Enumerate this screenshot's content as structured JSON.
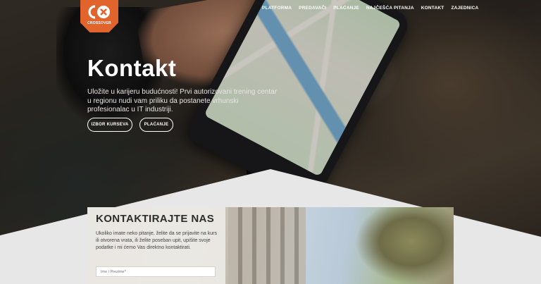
{
  "brand": {
    "logo_text": "CROSSOVER"
  },
  "nav": {
    "items": [
      {
        "label": "PLATFORMA"
      },
      {
        "label": "PREDAVAČI"
      },
      {
        "label": "PLAĆANJE"
      },
      {
        "label": "NAJČEŠĆA PITANJA"
      },
      {
        "label": "KONTAKT"
      },
      {
        "label": "ZAJEDNICA"
      }
    ]
  },
  "hero": {
    "title": "Kontakt",
    "lead": "Uložite u karijeru budućnosti! Prvi autorizovani trening centar u regionu nudi vam priliku da postanete vrhunski profesionalac u IT industriji.",
    "buttons": [
      {
        "label": "IZBOR KURSEVA"
      },
      {
        "label": "PLAĆANJE"
      }
    ]
  },
  "contact": {
    "title": "KONTAKTIRAJTE NAS",
    "text": "Ukoliko imate neko pitanje, želite da se prijavite na kurs ili otvorena vrata, ili želite poseban upit, upišite svoje podatke i mi ćemo Vas direktno kontaktirati.",
    "name_placeholder": "Ime i Prezime*"
  },
  "colors": {
    "accent": "#e0642c",
    "text_light": "#ffffff"
  }
}
